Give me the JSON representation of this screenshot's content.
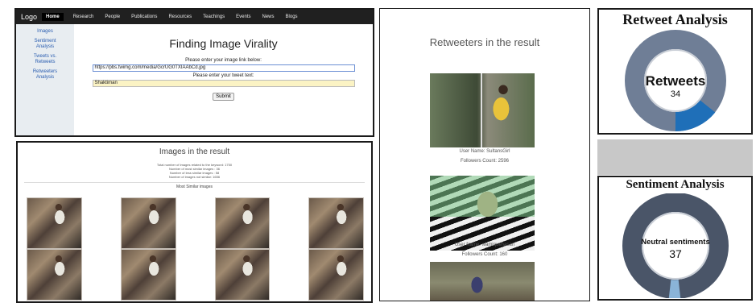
{
  "app": {
    "logo": "Logo",
    "nav": [
      "Home",
      "Research",
      "People",
      "Publications",
      "Resources",
      "Teachings",
      "Events",
      "News",
      "Blogs"
    ],
    "sidebar": [
      "Images",
      "Sentiment Analysis",
      "Tweets vs. Retweets",
      "Retweeters Analysis"
    ],
    "title": "Finding Image Virality",
    "image_link_label": "Please enter your image link below:",
    "image_link_value": "https://pbs.twimg.com/media/GcrUG0TXIAAbCd.jpg",
    "tweet_text_label": "Please enter your tweet text:",
    "tweet_text_value": "Shaktiman",
    "submit_label": "Submit"
  },
  "images_panel": {
    "title": "Images in the result",
    "stats": [
      "Total number of images related to the keyword: 1750",
      "Number of most similar images : 36",
      "Number of less similar images : 58",
      "Number of images not similar: 1656"
    ],
    "most_similar": "Most Similar images"
  },
  "retweeters": {
    "title": "Retweeters in the result",
    "users": [
      {
        "name": "User Name: SultansGirl",
        "followers": "Followers Count: 2596"
      },
      {
        "name": "User Name: wamiquehasan",
        "followers": "Followers Count: 160"
      }
    ]
  },
  "retweet_analysis": {
    "title": "Retweet Analysis",
    "center_label": "Retweets",
    "count": "34",
    "colors": {
      "ring": "#6f7e96",
      "highlight": "#1f6fb8",
      "inner_border": "#c9ced6"
    }
  },
  "sentiment_analysis": {
    "title": "Sentiment Analysis",
    "center_label": "Neutral sentiments",
    "count": "37",
    "colors": {
      "ring": "#4a5568",
      "highlight": "#8ab4d8",
      "inner_border": "#c9ced6"
    }
  }
}
